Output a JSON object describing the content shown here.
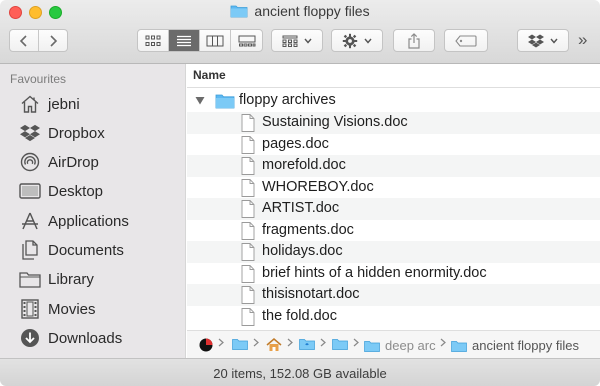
{
  "window": {
    "title": "ancient floppy files"
  },
  "toolbar": {
    "more_glyph": "»"
  },
  "sidebar": {
    "heading": "Favourites",
    "items": [
      {
        "label": "jebni",
        "icon": "home-icon"
      },
      {
        "label": "Dropbox",
        "icon": "dropbox-icon"
      },
      {
        "label": "AirDrop",
        "icon": "airdrop-icon"
      },
      {
        "label": "Desktop",
        "icon": "desktop-icon"
      },
      {
        "label": "Applications",
        "icon": "applications-icon"
      },
      {
        "label": "Documents",
        "icon": "documents-icon"
      },
      {
        "label": "Library",
        "icon": "folder-icon"
      },
      {
        "label": "Movies",
        "icon": "film-icon"
      },
      {
        "label": "Downloads",
        "icon": "download-icon"
      }
    ]
  },
  "list": {
    "column_name": "Name",
    "folder": "floppy archives",
    "files": [
      "Sustaining Visions.doc",
      "pages.doc",
      "morefold.doc",
      "WHOREBOY.doc",
      "ARTIST.doc",
      "fragments.doc",
      "holidays.doc",
      "brief hints of a hidden enormity.doc",
      "thisisnotart.doc",
      "the fold.doc"
    ]
  },
  "pathbar": {
    "segments": [
      "deep arc",
      "ancient floppy files"
    ]
  },
  "status": {
    "text": "20 items, 152.08 GB available"
  },
  "colors": {
    "folder_blue": "#5cb8f2",
    "close": "#ff5f57",
    "minimize": "#ffbd2e",
    "maximize": "#28c940"
  }
}
